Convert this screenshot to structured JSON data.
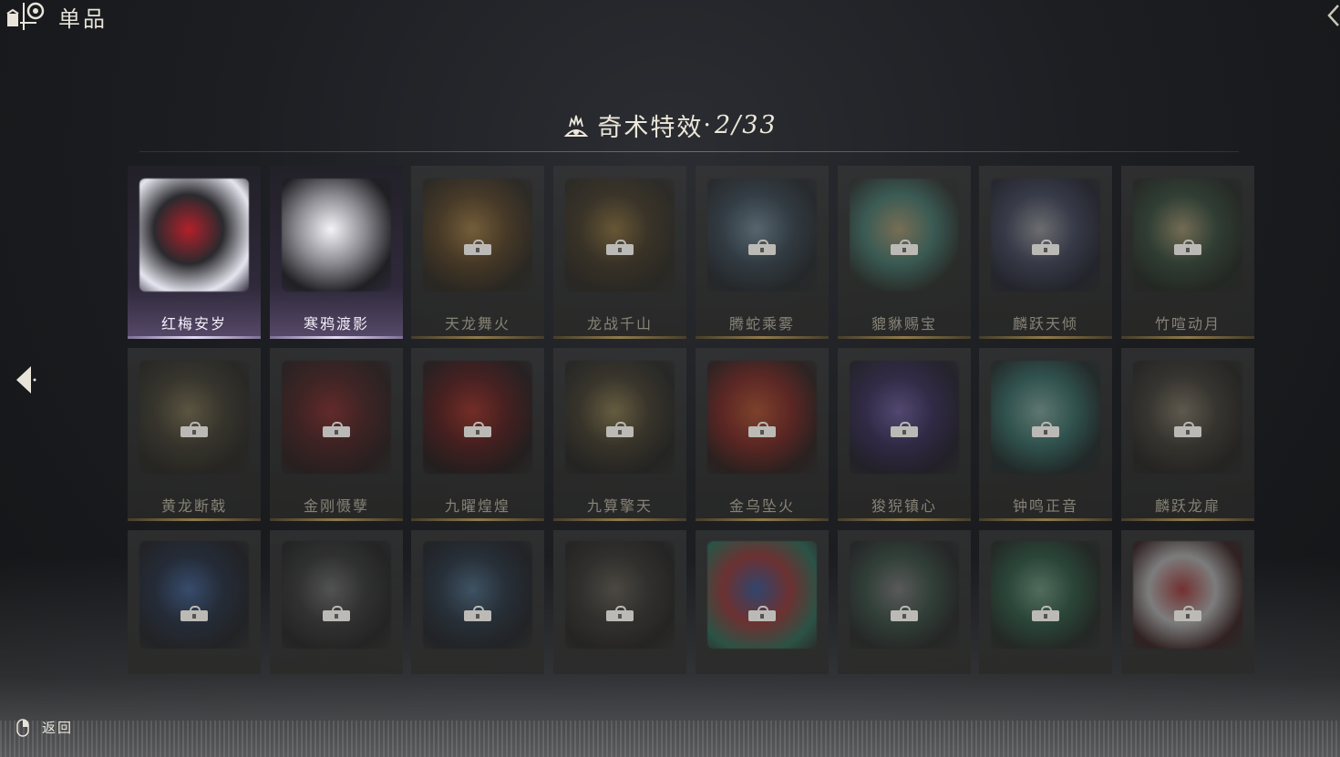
{
  "header": {
    "title": "单品"
  },
  "section": {
    "title": "奇术特效",
    "separator": "·",
    "progress": "2/33",
    "owned": 2,
    "total": 33
  },
  "items": [
    {
      "name": "红梅安岁",
      "owned": true,
      "art": "plum-blossom",
      "colors": [
        "#b3202a",
        "#2a2a2e",
        "#e6e6f0"
      ]
    },
    {
      "name": "寒鸦渡影",
      "owned": true,
      "art": "crow-vortex",
      "colors": [
        "#f4f4f8",
        "#8a8a90",
        "#202024"
      ]
    },
    {
      "name": "天龙舞火",
      "owned": false,
      "art": "golden-dragon",
      "colors": [
        "#d8a24a",
        "#6b4a1e",
        "#2a2418"
      ]
    },
    {
      "name": "龙战千山",
      "owned": false,
      "art": "golden-dragon",
      "colors": [
        "#b8903e",
        "#4a3a1e",
        "#282418"
      ]
    },
    {
      "name": "腾蛇乘雾",
      "owned": false,
      "art": "mist-serpent",
      "colors": [
        "#8fb2c8",
        "#3a5060",
        "#1e2428"
      ]
    },
    {
      "name": "貔貅赐宝",
      "owned": false,
      "art": "treasure-beast",
      "colors": [
        "#e0c98a",
        "#4f9b8a",
        "#2a3028"
      ]
    },
    {
      "name": "麟跃天倾",
      "owned": false,
      "art": "moon-rider",
      "colors": [
        "#c8c8d0",
        "#4a5070",
        "#1e2030"
      ]
    },
    {
      "name": "竹喧动月",
      "owned": false,
      "art": "full-moon",
      "colors": [
        "#d8c890",
        "#3a5a40",
        "#20281e"
      ]
    },
    {
      "name": "黄龙断戟",
      "owned": false,
      "art": "yellow-dragon",
      "colors": [
        "#a09060",
        "#4a4430",
        "#26241c"
      ]
    },
    {
      "name": "金刚慑孽",
      "owned": false,
      "art": "red-guardian",
      "colors": [
        "#b22a2a",
        "#5a1a1a",
        "#281616"
      ]
    },
    {
      "name": "九曜煌煌",
      "owned": false,
      "art": "red-eye",
      "colors": [
        "#d8301e",
        "#6a1010",
        "#1e1010"
      ]
    },
    {
      "name": "九算擎天",
      "owned": false,
      "art": "golden-burst",
      "colors": [
        "#b8a05a",
        "#4a4028",
        "#1e1e18"
      ]
    },
    {
      "name": "金乌坠火",
      "owned": false,
      "art": "fire-bird",
      "colors": [
        "#f0602a",
        "#a02018",
        "#2a1612"
      ]
    },
    {
      "name": "狻猊镇心",
      "owned": false,
      "art": "purple-lion",
      "colors": [
        "#8a70d0",
        "#3a2a6a",
        "#1a1628"
      ]
    },
    {
      "name": "钟鸣正音",
      "owned": false,
      "art": "jade-bell",
      "colors": [
        "#a8e0d0",
        "#3a8a80",
        "#1a2a28"
      ]
    },
    {
      "name": "麟跃龙扉",
      "owned": false,
      "art": "gate-pavilion",
      "colors": [
        "#a89c80",
        "#4a4438",
        "#22201c"
      ]
    },
    {
      "name": "",
      "owned": false,
      "art": "constellation",
      "colors": [
        "#4a7ac8",
        "#1e2e4a",
        "#16181e"
      ]
    },
    {
      "name": "",
      "owned": false,
      "art": "crane-wing",
      "colors": [
        "#8a8a8a",
        "#3a3a3a",
        "#1a1a1a"
      ]
    },
    {
      "name": "",
      "owned": false,
      "art": "star-ring",
      "colors": [
        "#5a8ab0",
        "#223448",
        "#15181e"
      ]
    },
    {
      "name": "",
      "owned": false,
      "art": "sleeping-beast",
      "colors": [
        "#7a7060",
        "#3a3630",
        "#1c1a18"
      ]
    },
    {
      "name": "",
      "owned": false,
      "art": "painted-rock",
      "colors": [
        "#3a6ac8",
        "#c83a3a",
        "#2a8a6a"
      ]
    },
    {
      "name": "",
      "owned": false,
      "art": "armored-horse",
      "colors": [
        "#9a9a9a",
        "#3a5a4a",
        "#1e2020"
      ]
    },
    {
      "name": "",
      "owned": false,
      "art": "jade-flower",
      "colors": [
        "#8ac8a0",
        "#2a6a4a",
        "#1a241e"
      ]
    },
    {
      "name": "",
      "owned": false,
      "art": "red-crane",
      "colors": [
        "#d83a3a",
        "#f0f0f0",
        "#3a1616"
      ]
    }
  ],
  "footer": {
    "back_label": "返回"
  },
  "icons": {
    "logo": "gift-box-icon",
    "section": "flame-eye-icon",
    "lock": "lock-icon",
    "left_arrow": "arrow-left-icon",
    "mouse": "mouse-right-icon",
    "collapse": "chevron-left-icon"
  }
}
